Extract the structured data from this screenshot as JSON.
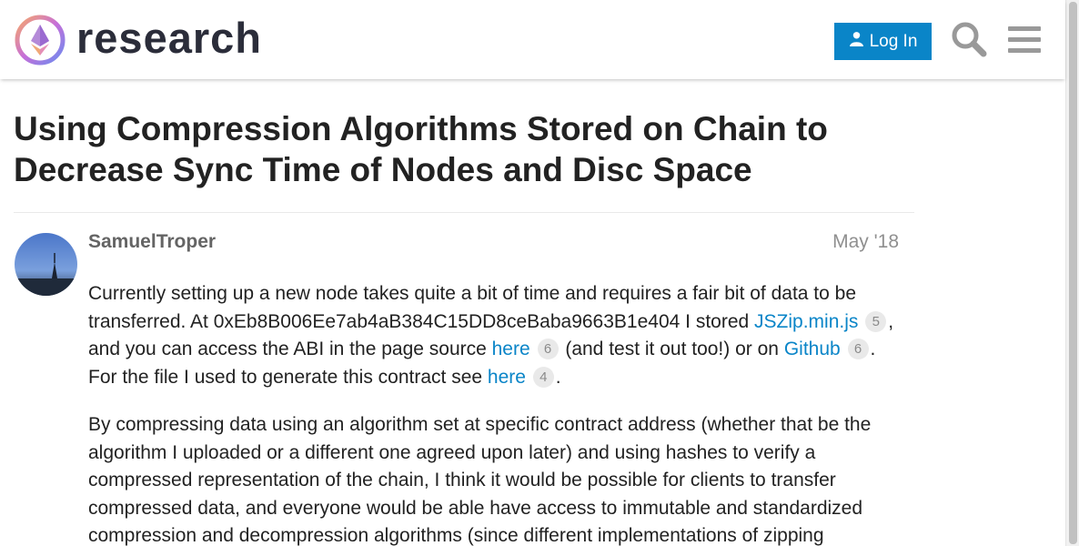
{
  "header": {
    "site_name": "research",
    "login_label": "Log In",
    "accent_color": "#0a85c8",
    "icons": [
      "ethereum-logo-icon",
      "user-icon",
      "search-icon",
      "hamburger-menu-icon"
    ]
  },
  "topic": {
    "title": "Using Compression Algorithms Stored on Chain to Decrease Sync Time of Nodes and Disc Space"
  },
  "post": {
    "author": "SamuelTroper",
    "date": "May '18",
    "p1": {
      "t1": "Currently setting up a new node takes quite a bit of time and requires a fair bit of data to be transferred. At 0xEb8B006Ee7ab4aB384C15DD8ceBaba9663B1e404 I stored ",
      "link1": "JSZip.min.js",
      "count1": "5",
      "t2": ", and you can access the ABI in the page source ",
      "link2": "here",
      "count2": "6",
      "t3": " (and test it out too!) or on ",
      "link3": "Github",
      "count3": "6",
      "t4": ". For the file I used to generate this contract see ",
      "link4": "here",
      "count4": "4",
      "t5": "."
    },
    "p2": "By compressing data using an algorithm set at specific contract address (whether that be the algorithm I uploaded or a different one agreed upon later) and using hashes to verify a compressed representation of the chain, I think it would be possible for clients to transfer compressed data, and everyone would be able have access to immutable and standardized compression and decompression algorithms (since different implementations of zipping"
  }
}
